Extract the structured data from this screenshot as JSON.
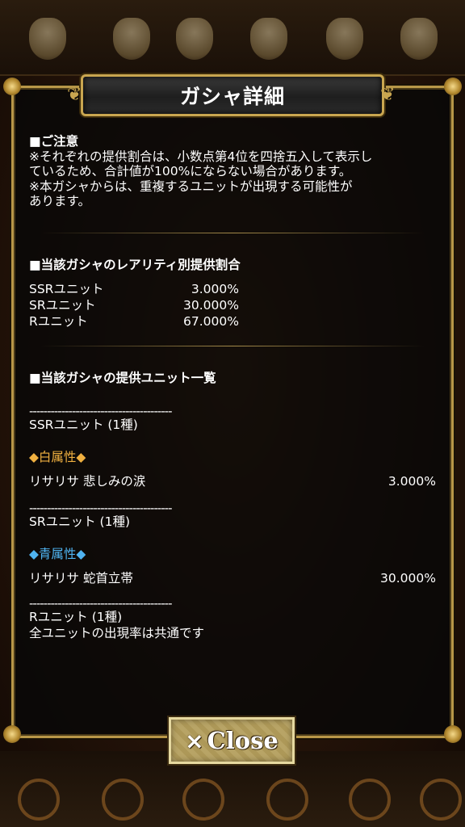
{
  "dialog": {
    "title": "ガシャ詳細",
    "close_label": "Close",
    "close_symbol": "×"
  },
  "notice": {
    "heading": "■ご注意",
    "lines": [
      "※それぞれの提供割合は、小数点第4位を四捨五入して表示し",
      "ているため、合計値が100%にならない場合があります。",
      "※本ガシャからは、重複するユニットが出現する可能性が",
      "あります。"
    ]
  },
  "rarity_rates": {
    "heading": "■当該ガシャのレアリティ別提供割合",
    "rows": [
      {
        "label": "SSRユニット",
        "value": "3.000%"
      },
      {
        "label": "SRユニット",
        "value": "30.000%"
      },
      {
        "label": "Rユニット",
        "value": "67.000%"
      }
    ]
  },
  "unit_list": {
    "heading": "■当該ガシャの提供ユニット一覧",
    "divider": "----------------------------------------",
    "ssr_header": "SSRユニット (1種)",
    "ssr_attr": "◆白属性◆",
    "ssr_unit": {
      "name": "リサリサ 悲しみの涙",
      "value": "3.000%"
    },
    "sr_header": "SRユニット (1種)",
    "sr_attr": "◆青属性◆",
    "sr_unit": {
      "name": "リサリサ 蛇首立帯",
      "value": "30.000%"
    },
    "r_header": "Rユニット (1種)",
    "r_note": "全ユニットの出現率は共通です"
  },
  "colors": {
    "frame_gold": "#b89748",
    "attr_white": "#f0b040",
    "attr_blue": "#4fb3f0"
  }
}
